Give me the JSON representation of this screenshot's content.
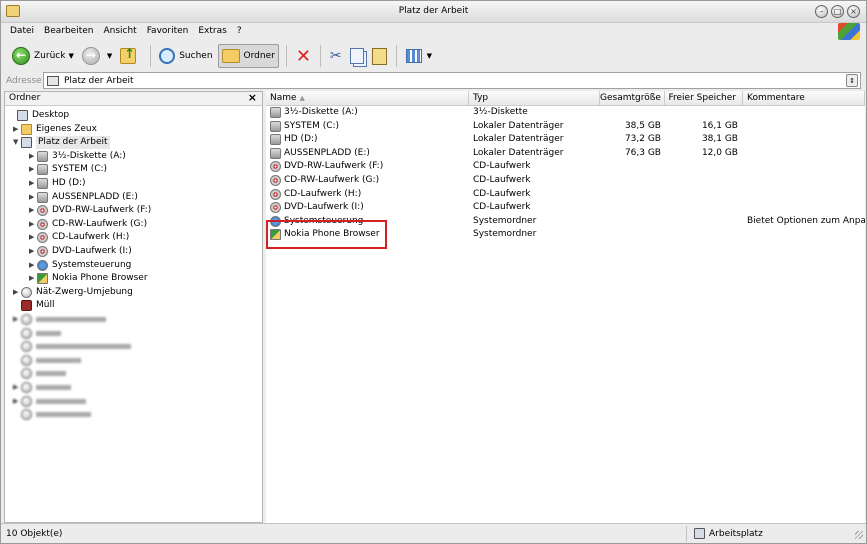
{
  "window": {
    "title": "Platz der Arbeit"
  },
  "menu": [
    "Datei",
    "Bearbeiten",
    "Ansicht",
    "Favoriten",
    "Extras",
    "?"
  ],
  "toolbar": {
    "back_label": "Zurück",
    "search_label": "Suchen",
    "folders_label": "Ordner"
  },
  "address": {
    "label": "Adresse",
    "value": "Platz der Arbeit"
  },
  "tree": {
    "header": "Ordner",
    "close_glyph": "×",
    "items": [
      {
        "label": "Desktop",
        "icon": "desktop-icon",
        "expander": ""
      },
      {
        "label": "Eigenes Zeux",
        "icon": "folder-icon",
        "expander": "▶"
      },
      {
        "label": "Platz der Arbeit",
        "icon": "computer-icon",
        "expander": "▼"
      },
      {
        "label": "3½-Diskette (A:)",
        "icon": "floppy-icon",
        "expander": "▶"
      },
      {
        "label": "SYSTEM (C:)",
        "icon": "drive-icon",
        "expander": "▶"
      },
      {
        "label": "HD (D:)",
        "icon": "drive-icon",
        "expander": "▶"
      },
      {
        "label": "AUSSENPLADD (E:)",
        "icon": "drive-icon",
        "expander": "▶"
      },
      {
        "label": "DVD-RW-Laufwerk (F:)",
        "icon": "cd-icon",
        "expander": "▶"
      },
      {
        "label": "CD-RW-Laufwerk (G:)",
        "icon": "cd-icon",
        "expander": "▶"
      },
      {
        "label": "CD-Laufwerk (H:)",
        "icon": "cd-icon",
        "expander": "▶"
      },
      {
        "label": "DVD-Laufwerk (I:)",
        "icon": "cd-icon",
        "expander": "▶"
      },
      {
        "label": "Systemsteuerung",
        "icon": "control-panel-icon",
        "expander": "▶"
      },
      {
        "label": "Nokia Phone Browser",
        "icon": "nokia-icon",
        "expander": "▶"
      },
      {
        "label": "Nät-Zwerg-Umjebung",
        "icon": "network-icon",
        "expander": "▶"
      },
      {
        "label": "Müll",
        "icon": "trash-icon",
        "expander": ""
      }
    ],
    "blurred_count": 8
  },
  "list": {
    "columns": {
      "name": "Name",
      "type": "Typ",
      "total": "Gesamtgröße",
      "free": "Freier Speicher",
      "comment": "Kommentare"
    },
    "rows": [
      {
        "name": "3½-Diskette (A:)",
        "type": "3½-Diskette",
        "total": "",
        "free": "",
        "comment": "",
        "icon": "floppy-icon"
      },
      {
        "name": "SYSTEM (C:)",
        "type": "Lokaler Datenträger",
        "total": "38,5 GB",
        "free": "16,1 GB",
        "comment": "",
        "icon": "drive-icon"
      },
      {
        "name": "HD (D:)",
        "type": "Lokaler Datenträger",
        "total": "73,2 GB",
        "free": "38,1 GB",
        "comment": "",
        "icon": "drive-icon"
      },
      {
        "name": "AUSSENPLADD (E:)",
        "type": "Lokaler Datenträger",
        "total": "76,3 GB",
        "free": "12,0 GB",
        "comment": "",
        "icon": "drive-icon"
      },
      {
        "name": "DVD-RW-Laufwerk (F:)",
        "type": "CD-Laufwerk",
        "total": "",
        "free": "",
        "comment": "",
        "icon": "cd-icon"
      },
      {
        "name": "CD-RW-Laufwerk (G:)",
        "type": "CD-Laufwerk",
        "total": "",
        "free": "",
        "comment": "",
        "icon": "cd-icon"
      },
      {
        "name": "CD-Laufwerk (H:)",
        "type": "CD-Laufwerk",
        "total": "",
        "free": "",
        "comment": "",
        "icon": "cd-icon"
      },
      {
        "name": "DVD-Laufwerk (I:)",
        "type": "CD-Laufwerk",
        "total": "",
        "free": "",
        "comment": "",
        "icon": "cd-icon"
      },
      {
        "name": "Systemsteuerung",
        "type": "Systemordner",
        "total": "",
        "free": "",
        "comment": "Bietet Optionen zum Anpa...",
        "icon": "control-panel-icon"
      },
      {
        "name": "Nokia Phone Browser",
        "type": "Systemordner",
        "total": "",
        "free": "",
        "comment": "",
        "icon": "nokia-icon"
      }
    ]
  },
  "status": {
    "count": "10 Objekt(e)",
    "location": "Arbeitsplatz"
  },
  "colors": {
    "highlight": "#d32020"
  }
}
